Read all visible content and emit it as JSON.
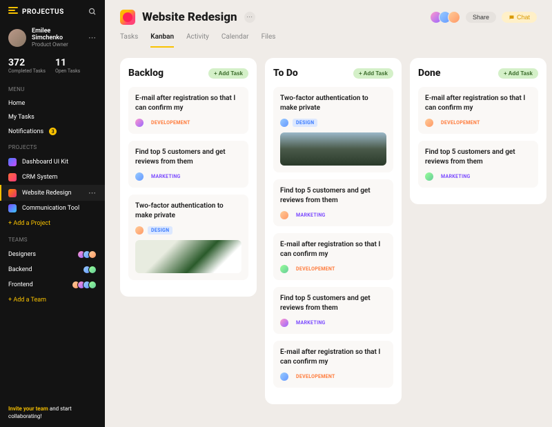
{
  "brand": "PROJECTUS",
  "user": {
    "name": "Emilee Simchenko",
    "role": "Product Owner"
  },
  "stats": {
    "completed_count": "372",
    "completed_label": "Completed Tasks",
    "open_count": "11",
    "open_label": "Open Tasks"
  },
  "menu": {
    "title": "MENU",
    "home": "Home",
    "mytasks": "My Tasks",
    "notifications": "Notifications",
    "notif_badge": "3"
  },
  "projects": {
    "title": "PROJECTS",
    "items": [
      {
        "label": "Dashboard UI Kit"
      },
      {
        "label": "CRM System"
      },
      {
        "label": "Website Redesign"
      },
      {
        "label": "Communication Tool"
      }
    ],
    "add": "+ Add a Project"
  },
  "teams": {
    "title": "TEAMS",
    "items": [
      {
        "label": "Designers"
      },
      {
        "label": "Backend"
      },
      {
        "label": "Frontend"
      }
    ],
    "add": "+ Add a Team"
  },
  "invite": {
    "link": "Invite your team",
    "text": " and start collaborating!"
  },
  "header": {
    "title": "Website Redesign",
    "share": "Share",
    "chat": "Chat"
  },
  "tabs": [
    "Tasks",
    "Kanban",
    "Activity",
    "Calendar",
    "Files"
  ],
  "active_tab": "Kanban",
  "add_task_label": "+ Add Task",
  "columns": [
    {
      "title": "Backlog",
      "cards": [
        {
          "title": "E-mail after registration so that I can confirm my",
          "tag": "DEVELOPEMENT",
          "tag_class": "tag-dev-plain"
        },
        {
          "title": "Find top 5 customers and get reviews from them",
          "tag": "MARKETING",
          "tag_class": "tag-mkt"
        },
        {
          "title": "Two-factor authentication to make private",
          "tag": "DESIGN",
          "tag_class": "tag-design",
          "img": "desk"
        }
      ]
    },
    {
      "title": "To Do",
      "cards": [
        {
          "title": "Two-factor authentication to make private",
          "tag": "DESIGN",
          "tag_class": "tag-design",
          "img": "land"
        },
        {
          "title": "Find top 5 customers and get reviews from them",
          "tag": "MARKETING",
          "tag_class": "tag-mkt"
        },
        {
          "title": "E-mail after registration so that I can confirm my",
          "tag": "DEVELOPEMENT",
          "tag_class": "tag-dev-plain"
        },
        {
          "title": "Find top 5 customers and get reviews from them",
          "tag": "MARKETING",
          "tag_class": "tag-mkt"
        },
        {
          "title": "E-mail after registration so that I can confirm my",
          "tag": "DEVELOPEMENT",
          "tag_class": "tag-dev-plain"
        }
      ]
    },
    {
      "title": "Done",
      "cards": [
        {
          "title": "E-mail after registration so that I can confirm my",
          "tag": "DEVELOPEMENT",
          "tag_class": "tag-dev-plain"
        },
        {
          "title": "Find top 5 customers and get reviews from them",
          "tag": "MARKETING",
          "tag_class": "tag-mkt"
        }
      ]
    }
  ]
}
